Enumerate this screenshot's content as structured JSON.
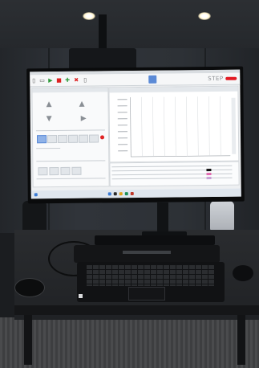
{
  "scene": {
    "description_colors": {
      "ceiling": "#2c2f33",
      "screen_bg": "#eef0f2",
      "accent_blue": "#5b8ad6",
      "brand_red": "#e21b23",
      "alert_red": "#e02424"
    }
  },
  "monitor": {
    "app_brand": "STEP",
    "toolbar_icons": [
      "document-icon",
      "folder-icon",
      "play-icon",
      "stop-icon",
      "add-icon",
      "close-icon",
      "document-icon"
    ]
  },
  "chart_panel": {
    "series_colors": [
      "#7f7f7f"
    ]
  },
  "table_panel": {
    "swatch_colors": [
      "#111111",
      "#e26bb0",
      "#c9a0d6"
    ]
  }
}
